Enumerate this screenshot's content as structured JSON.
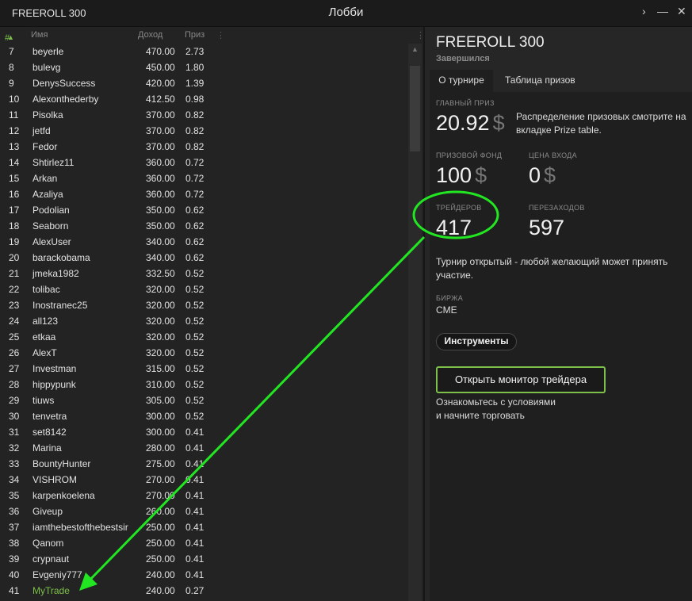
{
  "titlebar": {
    "app_name": "FREEROLL 300",
    "title": "Лобби",
    "chevron": "›",
    "minimize": "—",
    "close": "✕"
  },
  "table": {
    "headers": {
      "hash": "#",
      "name": "Имя",
      "income": "Доход",
      "prize": "Приз"
    },
    "rows": [
      {
        "n": "7",
        "name": "beyerle",
        "income": "470.00",
        "prize": "2.73"
      },
      {
        "n": "8",
        "name": "bulevg",
        "income": "450.00",
        "prize": "1.80"
      },
      {
        "n": "9",
        "name": "DenysSuccess",
        "income": "420.00",
        "prize": "1.39"
      },
      {
        "n": "10",
        "name": "Alexonthederby",
        "income": "412.50",
        "prize": "0.98"
      },
      {
        "n": "11",
        "name": "Pisolka",
        "income": "370.00",
        "prize": "0.82"
      },
      {
        "n": "12",
        "name": "jetfd",
        "income": "370.00",
        "prize": "0.82"
      },
      {
        "n": "13",
        "name": "Fedor",
        "income": "370.00",
        "prize": "0.82"
      },
      {
        "n": "14",
        "name": "Shtirlez11",
        "income": "360.00",
        "prize": "0.72"
      },
      {
        "n": "15",
        "name": "Arkan",
        "income": "360.00",
        "prize": "0.72"
      },
      {
        "n": "16",
        "name": "Azaliya",
        "income": "360.00",
        "prize": "0.72"
      },
      {
        "n": "17",
        "name": "Podolian",
        "income": "350.00",
        "prize": "0.62"
      },
      {
        "n": "18",
        "name": "Seaborn",
        "income": "350.00",
        "prize": "0.62"
      },
      {
        "n": "19",
        "name": "AlexUser",
        "income": "340.00",
        "prize": "0.62"
      },
      {
        "n": "20",
        "name": "barackobama",
        "income": "340.00",
        "prize": "0.62"
      },
      {
        "n": "21",
        "name": "jmeka1982",
        "income": "332.50",
        "prize": "0.52"
      },
      {
        "n": "22",
        "name": "tolibac",
        "income": "320.00",
        "prize": "0.52"
      },
      {
        "n": "23",
        "name": "Inostranec25",
        "income": "320.00",
        "prize": "0.52"
      },
      {
        "n": "24",
        "name": "all123",
        "income": "320.00",
        "prize": "0.52"
      },
      {
        "n": "25",
        "name": "etkaa",
        "income": "320.00",
        "prize": "0.52"
      },
      {
        "n": "26",
        "name": "AlexT",
        "income": "320.00",
        "prize": "0.52"
      },
      {
        "n": "27",
        "name": "Investman",
        "income": "315.00",
        "prize": "0.52"
      },
      {
        "n": "28",
        "name": "hippypunk",
        "income": "310.00",
        "prize": "0.52"
      },
      {
        "n": "29",
        "name": "tiuws",
        "income": "305.00",
        "prize": "0.52"
      },
      {
        "n": "30",
        "name": "tenvetra",
        "income": "300.00",
        "prize": "0.52"
      },
      {
        "n": "31",
        "name": "set8142",
        "income": "300.00",
        "prize": "0.41"
      },
      {
        "n": "32",
        "name": "Marina",
        "income": "280.00",
        "prize": "0.41"
      },
      {
        "n": "33",
        "name": "BountyHunter",
        "income": "275.00",
        "prize": "0.41"
      },
      {
        "n": "34",
        "name": "VISHROM",
        "income": "270.00",
        "prize": "0.41"
      },
      {
        "n": "35",
        "name": "karpenkoelena",
        "income": "270.00",
        "prize": "0.41"
      },
      {
        "n": "36",
        "name": "Giveup",
        "income": "260.00",
        "prize": "0.41"
      },
      {
        "n": "37",
        "name": "iamthebestofthebestsir",
        "income": "250.00",
        "prize": "0.41"
      },
      {
        "n": "38",
        "name": "Qanom",
        "income": "250.00",
        "prize": "0.41"
      },
      {
        "n": "39",
        "name": "crypnaut",
        "income": "250.00",
        "prize": "0.41"
      },
      {
        "n": "40",
        "name": "Evgeniy777",
        "income": "240.00",
        "prize": "0.41"
      },
      {
        "n": "41",
        "name": "MyTrade",
        "income": "240.00",
        "prize": "0.27"
      }
    ]
  },
  "tournament": {
    "title": "FREEROLL 300",
    "status": "Завершился",
    "tabs": [
      "О турнире",
      "Таблица призов"
    ],
    "main_prize_label": "ГЛАВНЫЙ ПРИЗ",
    "main_prize_value": "20.92",
    "currency": "$",
    "prize_note": "Распределение призовых смотрите на вкладке Prize table.",
    "prize_fund_label": "ПРИЗОВОЙ ФОНД",
    "prize_fund_value": "100",
    "entry_label": "ЦЕНА ВХОДА",
    "entry_value": "0",
    "traders_label": "ТРЕЙДЕРОВ",
    "traders_value": "417",
    "reentries_label": "ПЕРЕЗАХОДОВ",
    "reentries_value": "597",
    "open_note": "Турнир открытый - любой желающий может принять участие.",
    "exchange_label": "БИРЖА",
    "exchange_value": "CME",
    "instruments_button": "Инструменты",
    "open_monitor_button": "Открыть монитор трейдера",
    "conditions_note_1": "Ознакомьтесь с условиями",
    "conditions_note_2": "и начните торговать"
  },
  "annotation": {
    "color": "#22e622"
  },
  "colors": {
    "accent": "#7cc04a",
    "background": "#232323"
  }
}
